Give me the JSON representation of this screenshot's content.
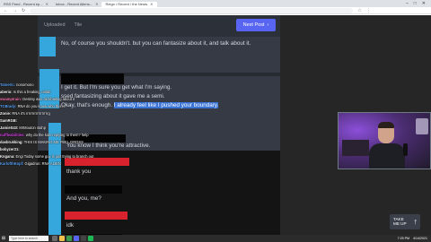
{
  "browser": {
    "tabs": [
      {
        "label": "RSS Feed - Recent ep...",
        "active": false
      },
      {
        "label": "Inbox - Recent Aliens...",
        "active": false
      },
      {
        "label": "Reign / Recent / the Nests",
        "active": true
      }
    ],
    "window_controls": [
      "–",
      "□",
      "✕"
    ],
    "url": ""
  },
  "app": {
    "nav": [
      "Uploaded",
      "Tile"
    ],
    "next_post_label": "Next Post",
    "next_post_icon": "chevron-right-icon",
    "messages": {
      "top": "No, of course you shouldn't. but you can fantasize about it, and talk about it.",
      "line1": "I get it. But I'm sure you get what I'm saying.",
      "line2": "ssed fantasizing about it gave me a semi.",
      "line3_plain": "Okay, that's enough.",
      "line3_highlight": "I already feel like I pushed your boundary.",
      "thank_you": "thank you",
      "you_know": "You know I think you're attractive.",
      "and_you": "And you, me?",
      "idk": "idk"
    }
  },
  "chat": [
    {
      "name": "Tatoerlc",
      "color": "#5da9ff",
      "text": "nonomono"
    },
    {
      "name": "aberio",
      "color": "#ffffff",
      "text": "Is this a freaking collab"
    },
    {
      "name": "swamptrain",
      "color": "#ff7ab8",
      "text": "Destiny was clickbaiting about it"
    },
    {
      "name": "TCBrady",
      "color": "#5da9ff",
      "text": "RNA do you know who this is"
    },
    {
      "name": "Zonie",
      "color": "#ffffff",
      "text": "RNA it's rrrrrrrrrrrrrrrrrrg"
    },
    {
      "name": "SamRGB",
      "color": "#ffffff",
      "text": ""
    },
    {
      "name": "JamieS43",
      "color": "#ffffff",
      "text": "MrMouton stahp"
    },
    {
      "name": "nuffleabilities",
      "color": "#d84ae8",
      "text": "why do the kids replying to them? help"
    },
    {
      "name": "dasbrukking",
      "color": "#ffffff",
      "text": "THIS IS MAKING ME FEEL GROSS"
    },
    {
      "name": "bobyzer21",
      "color": "#ffffff",
      "text": ""
    },
    {
      "name": "Kngana",
      "color": "#ffffff",
      "text": "Engi Today some guy is just trying to branch out"
    },
    {
      "name": "KarlofthKopf",
      "color": "#5da9ff",
      "text": "Gigadrun: RNA ALIEN"
    }
  ],
  "take_me_up": {
    "line1": "TAKE",
    "line2": "ME UP",
    "icon": "arrow-up-icon"
  },
  "taskbar": {
    "search_placeholder": "Type here to search",
    "tray": {
      "time": "7:25 PM",
      "date": "4/14/2021"
    }
  },
  "colors": {
    "accent": "#5865f2",
    "highlight": "#3a73d6",
    "marker": "#35a7dd",
    "redact_red": "#d8232e"
  }
}
